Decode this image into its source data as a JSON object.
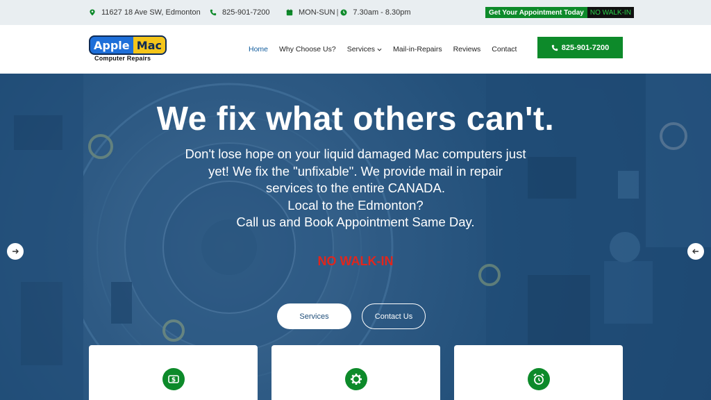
{
  "topbar": {
    "address": "11627 18 Ave SW, Edmonton",
    "phone": "825-901-7200",
    "days": "MON-SUN",
    "hours": "7.30am - 8.30pm",
    "appointment_label": "Get Your Appointment Today",
    "walkin_label": "NO WALK-IN"
  },
  "logo": {
    "word1": "Apple",
    "word2": "Mac",
    "tagline": "Computer Repairs"
  },
  "nav": {
    "items": [
      {
        "label": "Home"
      },
      {
        "label": "Why Choose Us?"
      },
      {
        "label": "Services"
      },
      {
        "label": "Mail-in-Repairs"
      },
      {
        "label": "Reviews"
      },
      {
        "label": "Contact"
      }
    ],
    "call_button": "825-901-7200"
  },
  "hero": {
    "title": "We fix what others can't.",
    "description_lines": [
      "Don't lose hope on your liquid damaged Mac computers just",
      "yet! We fix the \"unfixable\". We provide mail in repair",
      "services to the entire CANADA.",
      "Local to the Edmonton?",
      "Call us and Book Appointment Same Day."
    ],
    "notice": "NO WALK-IN",
    "btn_services": "Services",
    "btn_contact": "Contact Us"
  },
  "cards": [
    {
      "icon": "money-icon"
    },
    {
      "icon": "gear-icon"
    },
    {
      "icon": "alarm-clock-icon"
    }
  ],
  "colors": {
    "brand_green": "#0d8a2a",
    "hero_blue": "#23507a",
    "notice_red": "#e0261d",
    "nav_active": "#0e5a9c"
  }
}
